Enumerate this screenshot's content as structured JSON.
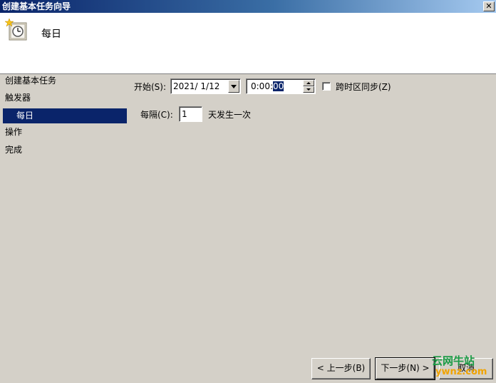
{
  "window": {
    "title": "创建基本任务向导",
    "close_glyph": "✕"
  },
  "header": {
    "title": "每日",
    "icon": "clock-icon"
  },
  "sidebar": {
    "items": [
      {
        "label": "创建基本任务"
      },
      {
        "label": "触发器"
      },
      {
        "label": "每日",
        "selected": true
      },
      {
        "label": "操作"
      },
      {
        "label": "完成"
      }
    ]
  },
  "form": {
    "start_label": "开始(S):",
    "start_date": "2021/  1/12",
    "start_time_prefix": "0:00:",
    "start_time_selected": "00",
    "sync_label": "跨时区同步(Z)",
    "sync_checked": false,
    "recur_label": "每隔(C):",
    "recur_value": "1",
    "recur_suffix": "天发生一次"
  },
  "buttons": {
    "back": "< 上一步(B)",
    "next": "下一步(N) >",
    "cancel": "取消"
  },
  "watermark": {
    "line1": "云网牛站",
    "line2": "ywnz.com"
  }
}
